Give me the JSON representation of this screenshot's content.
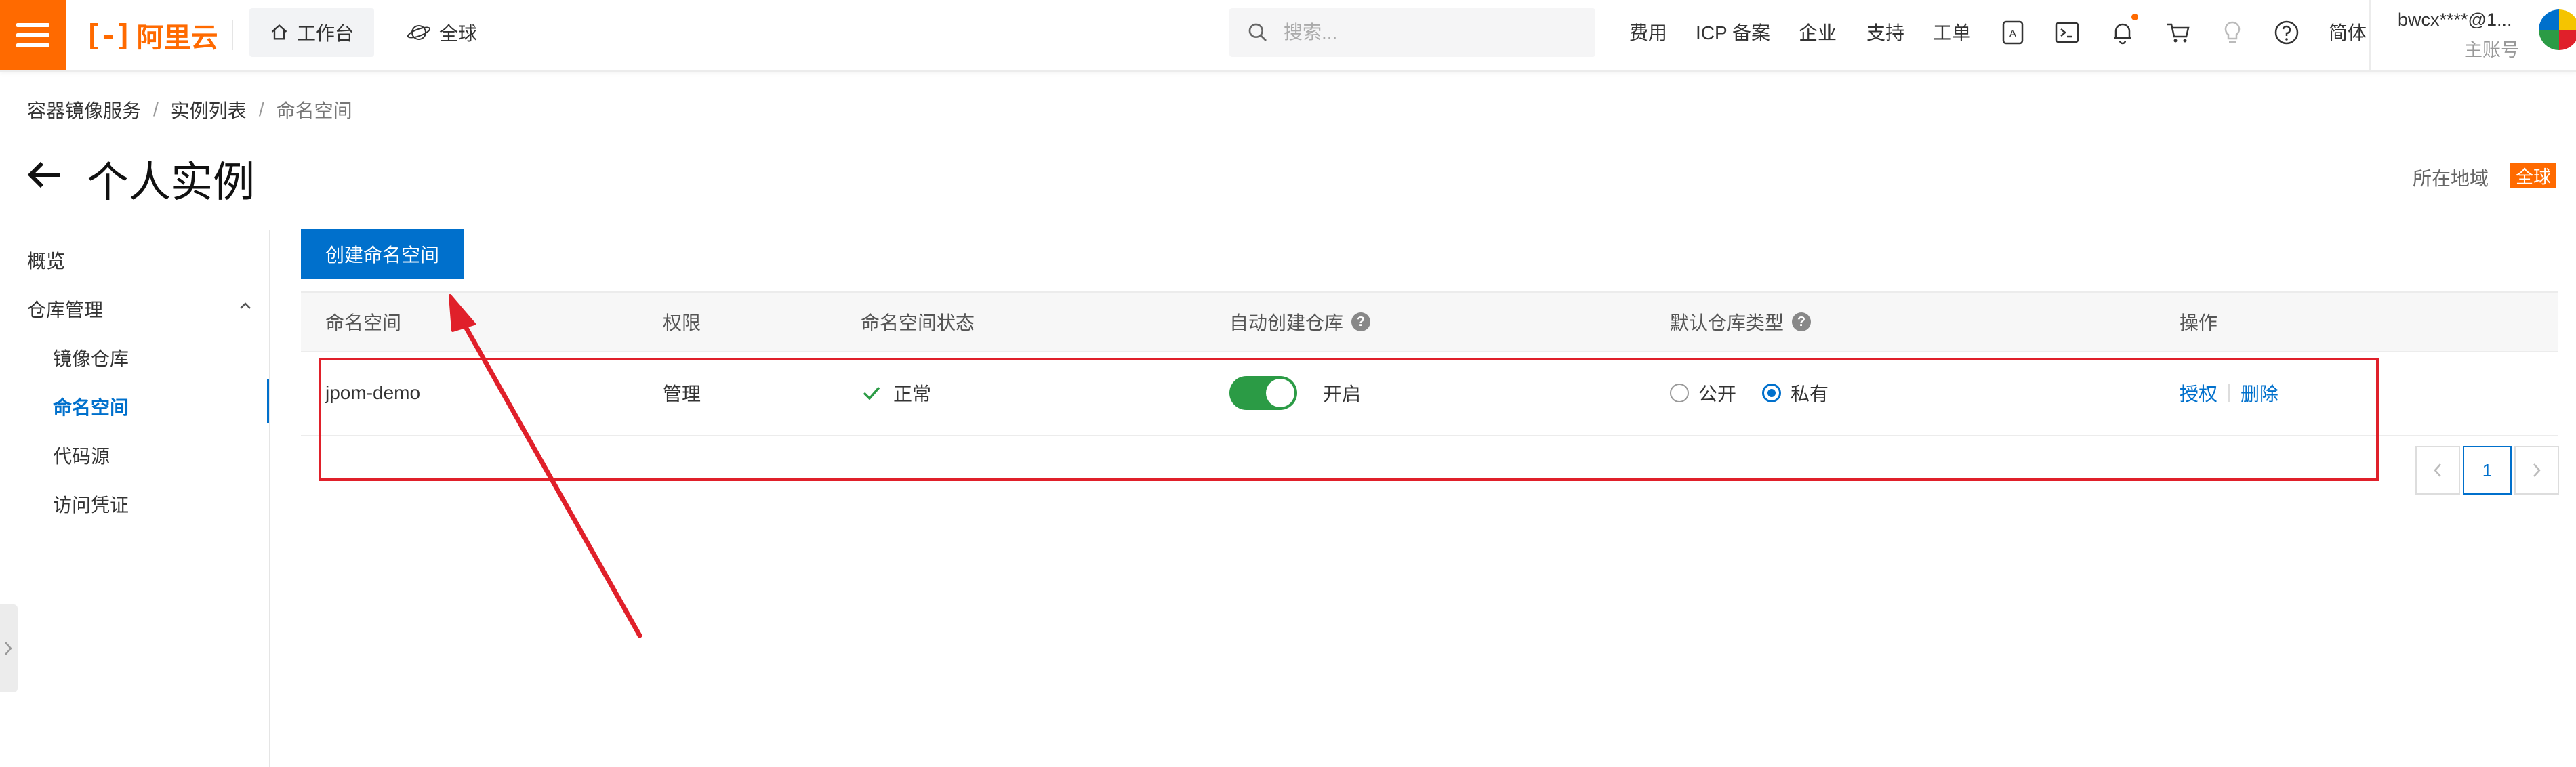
{
  "topbar": {
    "logo_text": "阿里云",
    "workbench_label": "工作台",
    "region_label": "全球",
    "search_placeholder": "搜索...",
    "nav_links": [
      "费用",
      "ICP 备案",
      "企业",
      "支持",
      "工单"
    ],
    "language_label": "简体",
    "user_name": "bwcx****@1...",
    "user_sub": "主账号",
    "icons": [
      "apple-icon",
      "terminal-icon",
      "bell-icon",
      "cart-icon",
      "lightbulb-icon",
      "help-icon"
    ]
  },
  "breadcrumb": {
    "items": [
      "容器镜像服务",
      "实例列表",
      "命名空间"
    ]
  },
  "page": {
    "title": "个人实例",
    "region_label": "所在地域",
    "region_value": "全球"
  },
  "sidebar": {
    "overview": "概览",
    "repo_manage": "仓库管理",
    "items": [
      "镜像仓库",
      "命名空间",
      "代码源",
      "访问凭证"
    ],
    "active_item": "命名空间"
  },
  "toolbar": {
    "create_label": "创建命名空间"
  },
  "table": {
    "headers": [
      "命名空间",
      "权限",
      "命名空间状态",
      "自动创建仓库",
      "默认仓库类型",
      "操作"
    ],
    "rows": [
      {
        "name": "jpom-demo",
        "permission": "管理",
        "status": "正常",
        "auto_create_enabled": true,
        "auto_create_label": "开启",
        "repo_type_options": [
          "公开",
          "私有"
        ],
        "repo_type_selected": "私有",
        "actions": [
          "授权",
          "删除"
        ]
      }
    ]
  },
  "pagination": {
    "current_page": "1"
  },
  "colors": {
    "brand": "#ff6a00",
    "primary": "#0070cc",
    "success": "#2b9b45",
    "annotation": "#e0202a"
  }
}
